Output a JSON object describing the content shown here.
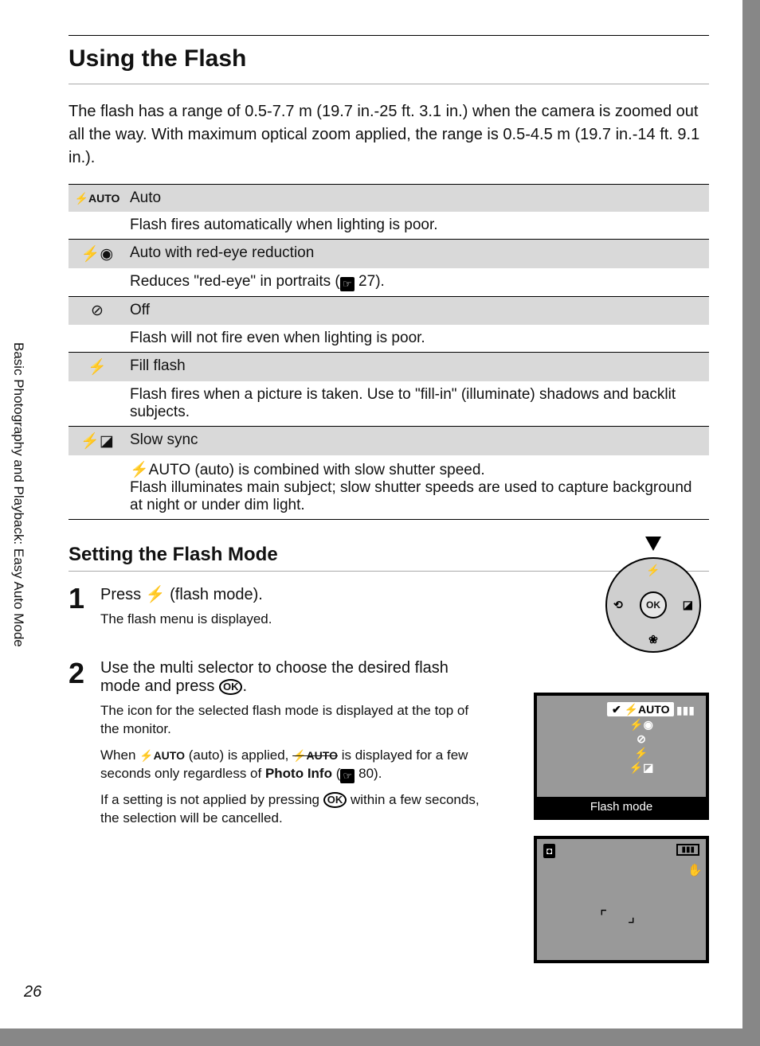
{
  "sidebar_label": "Basic Photography and Playback: Easy Auto Mode",
  "page_number": "26",
  "title": "Using the Flash",
  "intro": "The flash has a range of 0.5-7.7 m (19.7 in.-25 ft. 3.1 in.) when the camera is zoomed out all the way. With maximum optical zoom applied, the range is 0.5-4.5 m (19.7 in.-14 ft. 9.1 in.).",
  "modes": [
    {
      "icon": "⚡AUTO",
      "name": "Auto",
      "desc_pre": "Flash fires automatically when lighting is poor.",
      "ref": "",
      "desc_post": ""
    },
    {
      "icon": "⚡◉",
      "name": "Auto with red-eye reduction",
      "desc_pre": "Reduces \"red-eye\" in portraits (",
      "ref": "27",
      "desc_post": ")."
    },
    {
      "icon": "⊘",
      "name": "Off",
      "desc_pre": "Flash will not fire even when lighting is poor.",
      "ref": "",
      "desc_post": ""
    },
    {
      "icon": "⚡",
      "name": "Fill flash",
      "desc_pre": "Flash fires when a picture is taken. Use to \"fill-in\" (illuminate) shadows and backlit subjects.",
      "ref": "",
      "desc_post": ""
    },
    {
      "icon": "⚡◪",
      "name": "Slow sync",
      "desc_pre": "⚡AUTO (auto) is combined with slow shutter speed.\nFlash illuminates main subject; slow shutter speeds are used to capture background at night or under dim light.",
      "ref": "",
      "desc_post": ""
    }
  ],
  "subtitle": "Setting the Flash Mode",
  "step1": {
    "num": "1",
    "title_pre": "Press ",
    "title_icon": "⚡",
    "title_post": " (flash mode).",
    "body": "The flash menu is displayed."
  },
  "step2": {
    "num": "2",
    "title": "Use the multi selector to choose the desired flash mode and press ",
    "title_icon": "OK",
    "title_post": ".",
    "p1": "The icon for the selected flash mode is displayed at the top of the monitor.",
    "p2_pre": "When ",
    "p2_icon1": "⚡AUTO",
    "p2_mid": " (auto) is applied, ",
    "p2_icon2": "⚡AUTO",
    "p2_mid2": " is displayed for a few seconds only regardless of ",
    "p2_bold": "Photo Info",
    "p2_ref": "80",
    "p2_end": ").",
    "p3_pre": "If a setting is not applied by pressing ",
    "p3_icon": "OK",
    "p3_post": " within a few seconds, the selection will be cancelled."
  },
  "dial": {
    "ok": "OK",
    "up": "⚡",
    "down": "❀",
    "left": "⟲",
    "right": "◪"
  },
  "lcd1": {
    "label": "Flash mode",
    "sel": "✔ ⚡AUTO",
    "rows": [
      "⚡◉",
      "⊘",
      "⚡",
      "⚡◪"
    ],
    "batt": "▮▮▮"
  },
  "lcd2": {
    "cam": "◘",
    "batt": "▮▮▮",
    "hand": "✋",
    "brackets": "⌜ ⌟"
  }
}
